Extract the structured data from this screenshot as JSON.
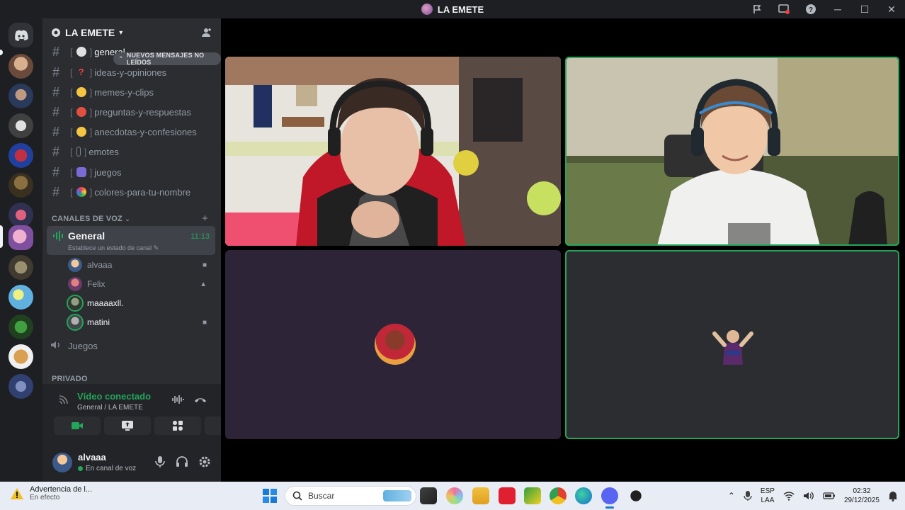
{
  "window": {
    "title": "LA EMETE"
  },
  "server": {
    "name": "LA EMETE"
  },
  "unread_banner": "NUEVOS MENSAJES NO LEÍDOS",
  "text_channels": [
    {
      "name": "general"
    },
    {
      "name": "ideas-y-opiniones"
    },
    {
      "name": "memes-y-clips"
    },
    {
      "name": "preguntas-y-respuestas"
    },
    {
      "name": "anecdotas-y-confesiones"
    },
    {
      "name": "emotes"
    },
    {
      "name": "juegos"
    },
    {
      "name": "colores-para-tu-nombre"
    }
  ],
  "voice_category": "CANALES DE VOZ",
  "voice_channel": {
    "name": "General",
    "time": "11:13",
    "status_hint": "Establece un estado de canal",
    "users": [
      {
        "name": "alvaaa"
      },
      {
        "name": "Felix"
      },
      {
        "name": "maaaaxll."
      },
      {
        "name": "matini"
      }
    ]
  },
  "voice_channel_2": {
    "name": "Juegos"
  },
  "private_category": "PRIVADO",
  "voice_panel": {
    "status": "Vídeo conectado",
    "location": "General / LA EMETE"
  },
  "user_panel": {
    "username": "alvaaa",
    "status": "En canal de voz"
  },
  "taskbar": {
    "notice_title": "Advertencia de l...",
    "notice_sub": "En efecto",
    "search_placeholder": "Buscar",
    "lang_top": "ESP",
    "lang_bottom": "LAA",
    "time": "02:32",
    "date": "29/12/2025"
  },
  "colors": {
    "accent_green": "#23a55a",
    "sidebar_bg": "#2b2d31",
    "rail_bg": "#1e1f22"
  },
  "icons": [
    "discord-logo-icon",
    "hashtag-icon",
    "speaker-icon",
    "camera-icon",
    "screen-share-icon",
    "activities-icon",
    "soundboard-icon",
    "microphone-icon",
    "headphones-icon",
    "gear-icon",
    "hang-up-icon",
    "add-member-icon",
    "windows-start-icon",
    "search-icon",
    "wifi-icon",
    "volume-icon",
    "battery-icon"
  ]
}
